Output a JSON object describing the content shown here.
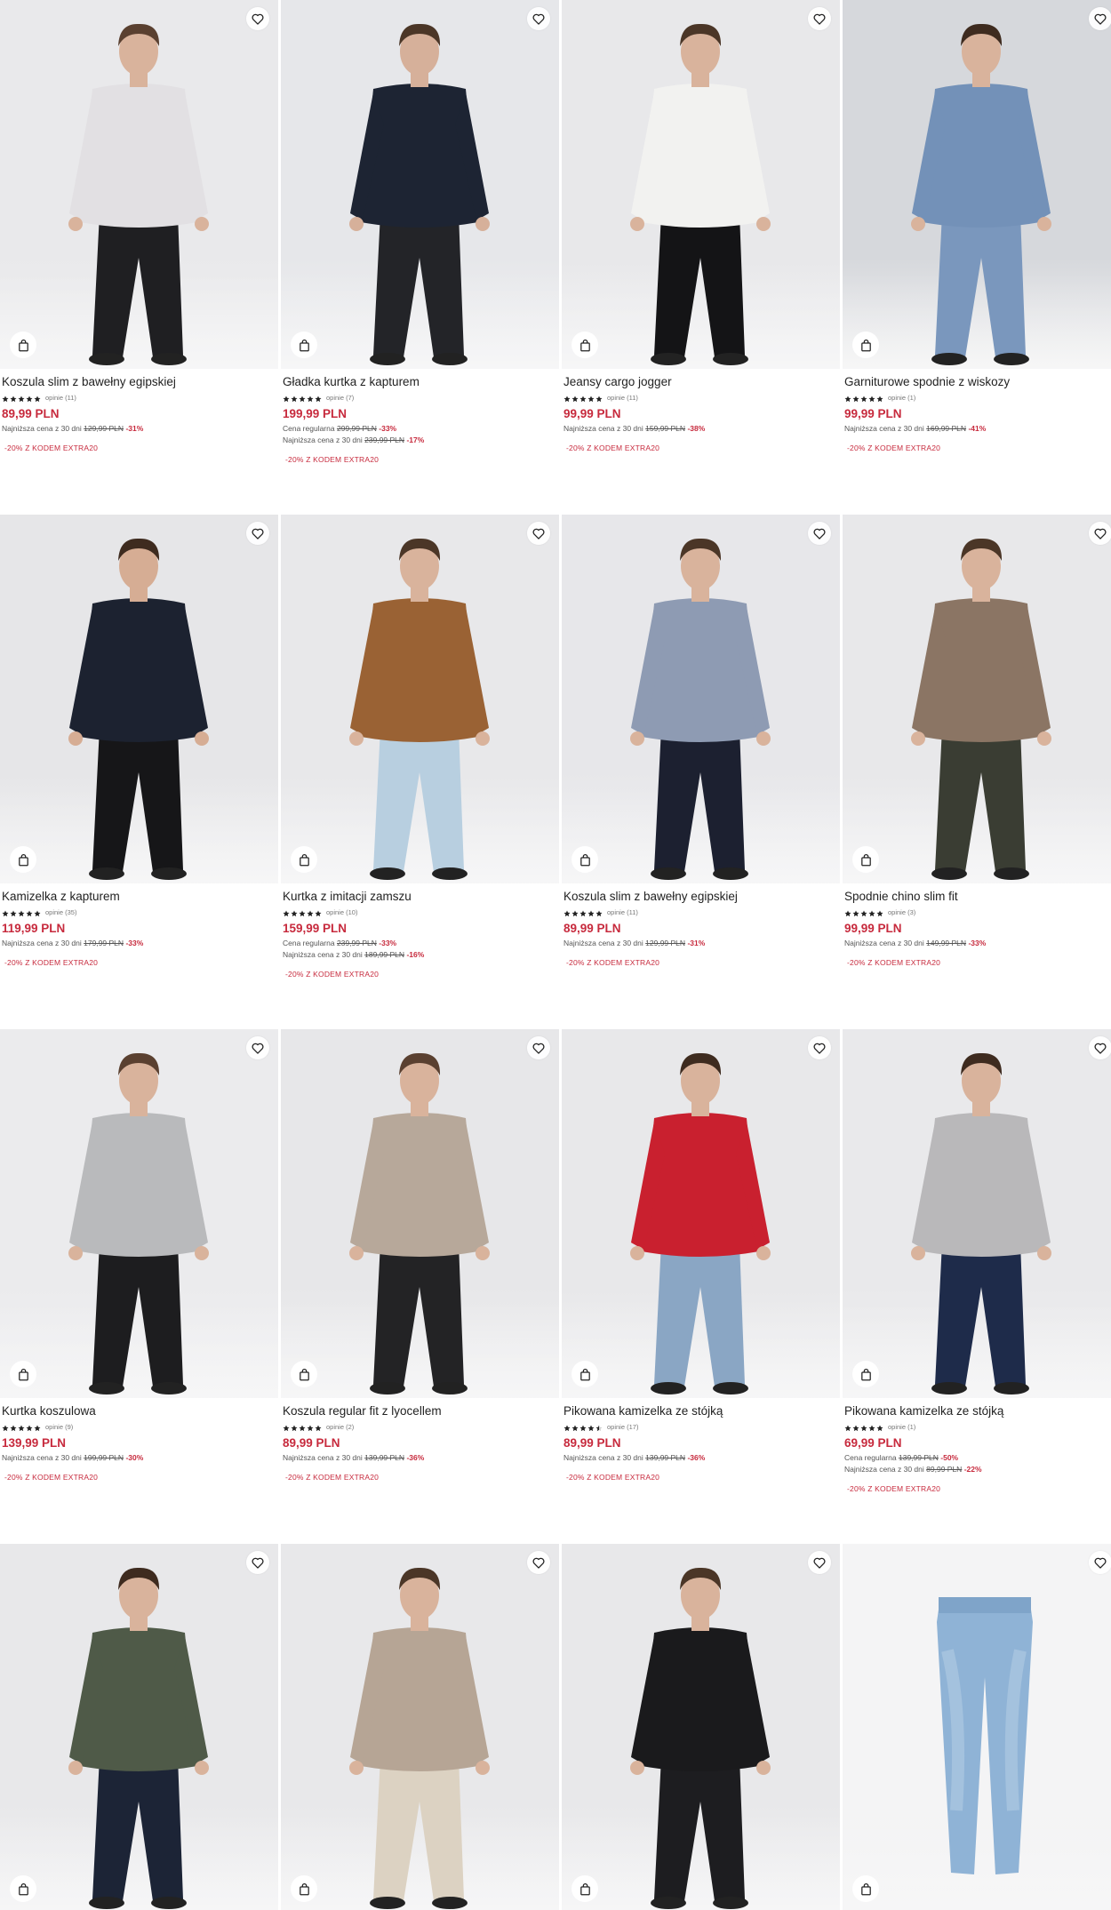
{
  "products": [
    {
      "name": "Koszula slim z bawełny egipskiej",
      "reviews": "opinie (11)",
      "stars": 5,
      "price": "89,99 PLN",
      "lines": [
        {
          "label": "Najniższa cena z 30 dni",
          "old": "129,99 PLN",
          "disc": "-31%"
        }
      ],
      "promo": "-20% Z KODEM EXTRA20",
      "bg": "#e9e9eb",
      "garment": "#e2e0e3",
      "trousers": "#1f1f22",
      "skin": "#d9b39c",
      "hair": "#5a4030"
    },
    {
      "name": "Gładka kurtka z kapturem",
      "reviews": "opinie (7)",
      "stars": 5,
      "price": "199,99 PLN",
      "lines": [
        {
          "label": "Cena regularna",
          "old": "299,99 PLN",
          "disc": "-33%"
        },
        {
          "label": "Najniższa cena z 30 dni",
          "old": "239,99 PLN",
          "disc": "-17%"
        }
      ],
      "promo": "-20% Z KODEM EXTRA20",
      "bg": "#e6e7ea",
      "garment": "#1d2433",
      "trousers": "#232428",
      "skin": "#d6b09a",
      "hair": "#4b3627"
    },
    {
      "name": "Jeansy cargo jogger",
      "reviews": "opinie (11)",
      "stars": 5,
      "price": "99,99 PLN",
      "lines": [
        {
          "label": "Najniższa cena z 30 dni",
          "old": "159,99 PLN",
          "disc": "-38%"
        }
      ],
      "promo": "-20% Z KODEM EXTRA20",
      "bg": "#e8e8ea",
      "garment": "#f2f2f0",
      "trousers": "#141416",
      "skin": "#d9b39c",
      "hair": "#4b3627"
    },
    {
      "name": "Garniturowe spodnie z wiskozy",
      "reviews": "opinie (1)",
      "stars": 5,
      "price": "99,99 PLN",
      "lines": [
        {
          "label": "Najniższa cena z 30 dni",
          "old": "169,99 PLN",
          "disc": "-41%"
        }
      ],
      "promo": "-20% Z KODEM EXTRA20",
      "bg": "#d6d8dc",
      "garment": "#7391b8",
      "trousers": "#7a97bd",
      "skin": "#d9b39c",
      "hair": "#3e2b1f"
    },
    {
      "name": "Kamizelka z kapturem",
      "reviews": "opinie (35)",
      "stars": 5,
      "price": "119,99 PLN",
      "lines": [
        {
          "label": "Najniższa cena z 30 dni",
          "old": "179,99 PLN",
          "disc": "-33%"
        }
      ],
      "promo": "-20% Z KODEM EXTRA20",
      "bg": "#e6e6e8",
      "garment": "#1c2230",
      "trousers": "#161618",
      "skin": "#d6ad94",
      "hair": "#3e2b1f"
    },
    {
      "name": "Kurtka z imitacji zamszu",
      "reviews": "opinie (10)",
      "stars": 5,
      "price": "159,99 PLN",
      "lines": [
        {
          "label": "Cena regularna",
          "old": "239,99 PLN",
          "disc": "-33%"
        },
        {
          "label": "Najniższa cena z 30 dni",
          "old": "189,99 PLN",
          "disc": "-16%"
        }
      ],
      "promo": "-20% Z KODEM EXTRA20",
      "bg": "#e8e8ea",
      "garment": "#9a6234",
      "trousers": "#b8cfe0",
      "skin": "#d9b39c",
      "hair": "#4b3627"
    },
    {
      "name": "Koszula slim z bawełny egipskiej",
      "reviews": "opinie (11)",
      "stars": 5,
      "price": "89,99 PLN",
      "lines": [
        {
          "label": "Najniższa cena z 30 dni",
          "old": "129,99 PLN",
          "disc": "-31%"
        }
      ],
      "promo": "-20% Z KODEM EXTRA20",
      "bg": "#e7e7ea",
      "garment": "#8e9bb3",
      "trousers": "#1c2030",
      "skin": "#d9b39c",
      "hair": "#4b3627"
    },
    {
      "name": "Spodnie chino slim fit",
      "reviews": "opinie (3)",
      "stars": 5,
      "price": "99,99 PLN",
      "lines": [
        {
          "label": "Najniższa cena z 30 dni",
          "old": "149,99 PLN",
          "disc": "-33%"
        }
      ],
      "promo": "-20% Z KODEM EXTRA20",
      "bg": "#e8e8ea",
      "garment": "#8b7564",
      "trousers": "#3a3d33",
      "skin": "#d9b39c",
      "hair": "#4b3627"
    },
    {
      "name": "Kurtka koszulowa",
      "reviews": "opinie (9)",
      "stars": 5,
      "price": "139,99 PLN",
      "lines": [
        {
          "label": "Najniższa cena z 30 dni",
          "old": "199,99 PLN",
          "disc": "-30%"
        }
      ],
      "promo": "-20% Z KODEM EXTRA20",
      "bg": "#ebebed",
      "garment": "#b9babc",
      "trousers": "#1d1d1f",
      "skin": "#d9b39c",
      "hair": "#5a4030"
    },
    {
      "name": "Koszula regular fit z lyocellem",
      "reviews": "opinie (2)",
      "stars": 5,
      "price": "89,99 PLN",
      "lines": [
        {
          "label": "Najniższa cena z 30 dni",
          "old": "139,99 PLN",
          "disc": "-36%"
        }
      ],
      "promo": "-20% Z KODEM EXTRA20",
      "bg": "#e7e7e9",
      "garment": "#b7a89a",
      "trousers": "#232325",
      "skin": "#d9b39c",
      "hair": "#5a4030"
    },
    {
      "name": "Pikowana kamizelka ze stójką",
      "reviews": "opinie (17)",
      "stars": 4,
      "price": "89,99 PLN",
      "lines": [
        {
          "label": "Najniższa cena z 30 dni",
          "old": "139,99 PLN",
          "disc": "-36%"
        }
      ],
      "promo": "-20% Z KODEM EXTRA20",
      "bg": "#e8e8ea",
      "garment": "#c9202f",
      "trousers": "#8aa6c4",
      "skin": "#d9b39c",
      "hair": "#3e2b1f"
    },
    {
      "name": "Pikowana kamizelka ze stójką",
      "reviews": "opinie (1)",
      "stars": 5,
      "price": "69,99 PLN",
      "lines": [
        {
          "label": "Cena regularna",
          "old": "139,99 PLN",
          "disc": "-50%"
        },
        {
          "label": "Najniższa cena z 30 dni",
          "old": "89,99 PLN",
          "disc": "-22%"
        }
      ],
      "promo": "-20% Z KODEM EXTRA20",
      "bg": "#e9e9eb",
      "garment": "#b9b8ba",
      "trousers": "#1e2b4a",
      "skin": "#d9b39c",
      "hair": "#3e2b1f"
    },
    {
      "name": "",
      "reviews": "",
      "stars": 0,
      "price": "",
      "lines": [],
      "promo": "",
      "bg": "#e8e8ea",
      "garment": "#4f5a48",
      "trousers": "#1c2436",
      "skin": "#d9b39c",
      "hair": "#3e2b1f"
    },
    {
      "name": "",
      "reviews": "",
      "stars": 0,
      "price": "",
      "lines": [],
      "promo": "",
      "bg": "#e8e8ea",
      "garment": "#b6a595",
      "trousers": "#dcd2c2",
      "skin": "#d9b39c",
      "hair": "#4b3627"
    },
    {
      "name": "",
      "reviews": "",
      "stars": 0,
      "price": "",
      "lines": [],
      "promo": "",
      "bg": "#e8e8ea",
      "garment": "#1a1a1c",
      "trousers": "#1d1d20",
      "skin": "#d9b39c",
      "hair": "#4b3627"
    },
    {
      "name": "",
      "reviews": "",
      "stars": 0,
      "price": "",
      "lines": [],
      "promo": "",
      "bg": "#f4f4f5",
      "garment": "#8fb3d6",
      "trousers": "#8fb3d6",
      "skin": "#f4f4f5",
      "hair": "#f4f4f5"
    }
  ]
}
